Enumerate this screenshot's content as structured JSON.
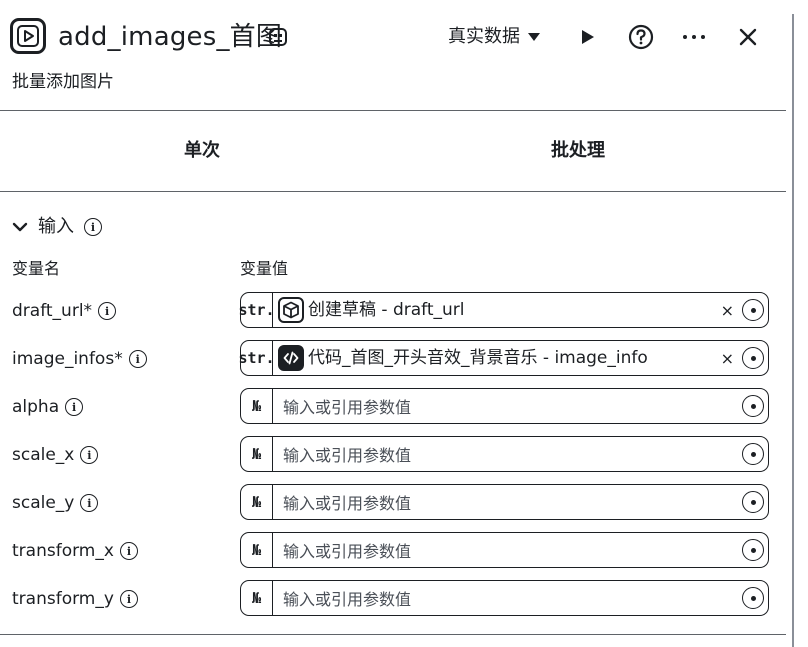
{
  "header": {
    "title": "add_images_首图",
    "subtitle": "批量添加图片",
    "data_mode": "真实数据"
  },
  "tabs": [
    {
      "label": "单次"
    },
    {
      "label": "批处理"
    }
  ],
  "input_section": {
    "title": "输入",
    "col_name": "变量名",
    "col_value": "变量值",
    "params": [
      {
        "name": "draft_url*",
        "type": "str.",
        "value": "创建草稿 - draft_url",
        "ref_icon": "box-icon",
        "clearable": true
      },
      {
        "name": "image_infos*",
        "type": "str.",
        "value": "代码_首图_开头音效_背景音乐 - image_info",
        "ref_icon": "code-icon",
        "clearable": true
      },
      {
        "name": "alpha",
        "type": "№",
        "placeholder": "输入或引用参数值"
      },
      {
        "name": "scale_x",
        "type": "№",
        "placeholder": "输入或引用参数值"
      },
      {
        "name": "scale_y",
        "type": "№",
        "placeholder": "输入或引用参数值"
      },
      {
        "name": "transform_x",
        "type": "№",
        "placeholder": "输入或引用参数值"
      },
      {
        "name": "transform_y",
        "type": "№",
        "placeholder": "输入或引用参数值"
      }
    ]
  },
  "clear_glyph": "×",
  "info_glyph": "i"
}
